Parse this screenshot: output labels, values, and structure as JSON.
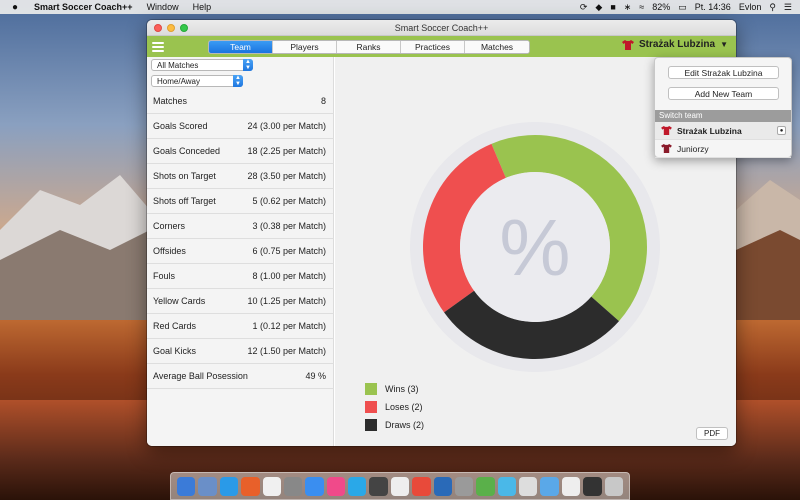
{
  "menubar": {
    "app_name": "Smart Soccer Coach++",
    "items": [
      "Window",
      "Help"
    ],
    "battery": "82%",
    "clock": "Pt. 14:36",
    "user": "Evlon"
  },
  "window": {
    "title": "Smart Soccer Coach++",
    "tabs": [
      {
        "label": "Team",
        "active": true
      },
      {
        "label": "Players",
        "active": false
      },
      {
        "label": "Ranks",
        "active": false
      },
      {
        "label": "Practices",
        "active": false
      },
      {
        "label": "Matches",
        "active": false
      }
    ],
    "current_team": "Strażak Lubzina"
  },
  "filters": {
    "match_filter": "All Matches",
    "location_filter": "Home/Away"
  },
  "stats": [
    {
      "label": "Matches",
      "value": "8"
    },
    {
      "label": "Goals Scored",
      "value": "24 (3.00 per Match)"
    },
    {
      "label": "Goals Conceded",
      "value": "18 (2.25 per Match)"
    },
    {
      "label": "Shots on Target",
      "value": "28 (3.50 per Match)"
    },
    {
      "label": "Shots off Target",
      "value": "5 (0.62 per Match)"
    },
    {
      "label": "Corners",
      "value": "3 (0.38 per Match)"
    },
    {
      "label": "Offsides",
      "value": "6 (0.75 per Match)"
    },
    {
      "label": "Fouls",
      "value": "8 (1.00 per Match)"
    },
    {
      "label": "Yellow Cards",
      "value": "10 (1.25 per Match)"
    },
    {
      "label": "Red Cards",
      "value": "1 (0.12 per Match)"
    },
    {
      "label": "Goal Kicks",
      "value": "12 (1.50 per Match)"
    },
    {
      "label": "Average Ball Posession",
      "value": "49 %"
    }
  ],
  "chart_data": {
    "type": "pie",
    "center_symbol": "%",
    "slices": [
      {
        "label": "Wins (3)",
        "value": 3,
        "color": "#9ac34f"
      },
      {
        "label": "Loses (2)",
        "value": 2,
        "color": "#ef4f4f"
      },
      {
        "label": "Draws (2)",
        "value": 2,
        "color": "#2c2c2c"
      }
    ]
  },
  "pdf_label": "PDF",
  "popover": {
    "edit_label": "Edit Strażak Lubzina",
    "add_label": "Add New Team",
    "section_label": "Switch team",
    "teams": [
      {
        "name": "Strażak Lubzina",
        "selected": true
      },
      {
        "name": "Juniorzy",
        "selected": false
      }
    ]
  },
  "colors": {
    "accent_green": "#9ac34f",
    "accent_blue": "#1a74e0",
    "shirt_red": "#c0182a"
  }
}
